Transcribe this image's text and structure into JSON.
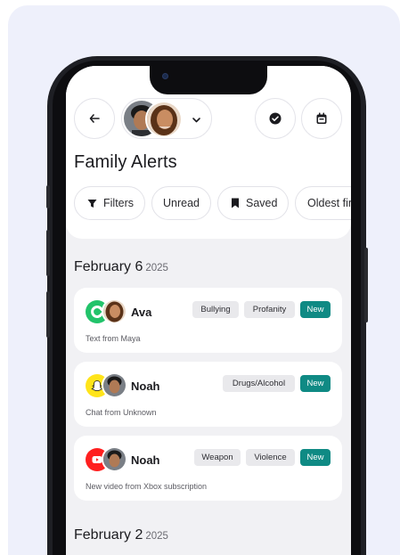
{
  "header": {
    "title": "Family Alerts"
  },
  "icons": {
    "back": "arrow-left-icon",
    "dropdown": "chevron-down-icon",
    "check": "check-circle-icon",
    "calendar": "calendar-icon"
  },
  "filters": [
    {
      "label": "Filters",
      "icon": "filter-icon"
    },
    {
      "label": "Unread"
    },
    {
      "label": "Saved",
      "icon": "bookmark-icon"
    },
    {
      "label": "Oldest first"
    }
  ],
  "groups": [
    {
      "date": "February 6",
      "year": "2025",
      "alerts": [
        {
          "app": "messages",
          "app_color": "#22c36a",
          "name": "Ava",
          "tags": [
            "Bullying",
            "Profanity"
          ],
          "badge": "New",
          "detail": "Text from Maya"
        },
        {
          "app": "snapchat",
          "app_color": "#ffe41a",
          "name": "Noah",
          "tags": [
            "Drugs/Alcohol"
          ],
          "badge": "New",
          "detail": "Chat from Unknown"
        },
        {
          "app": "youtube",
          "app_color": "#ff1f1f",
          "name": "Noah",
          "tags": [
            "Weapon",
            "Violence"
          ],
          "badge": "New",
          "detail": "New video from Xbox subscription"
        }
      ]
    },
    {
      "date": "February 2",
      "year": "2025",
      "alerts": []
    }
  ],
  "colors": {
    "accent_new": "#0f8a84",
    "background": "#eef0fb",
    "screen_bg": "#f1f1f4"
  }
}
